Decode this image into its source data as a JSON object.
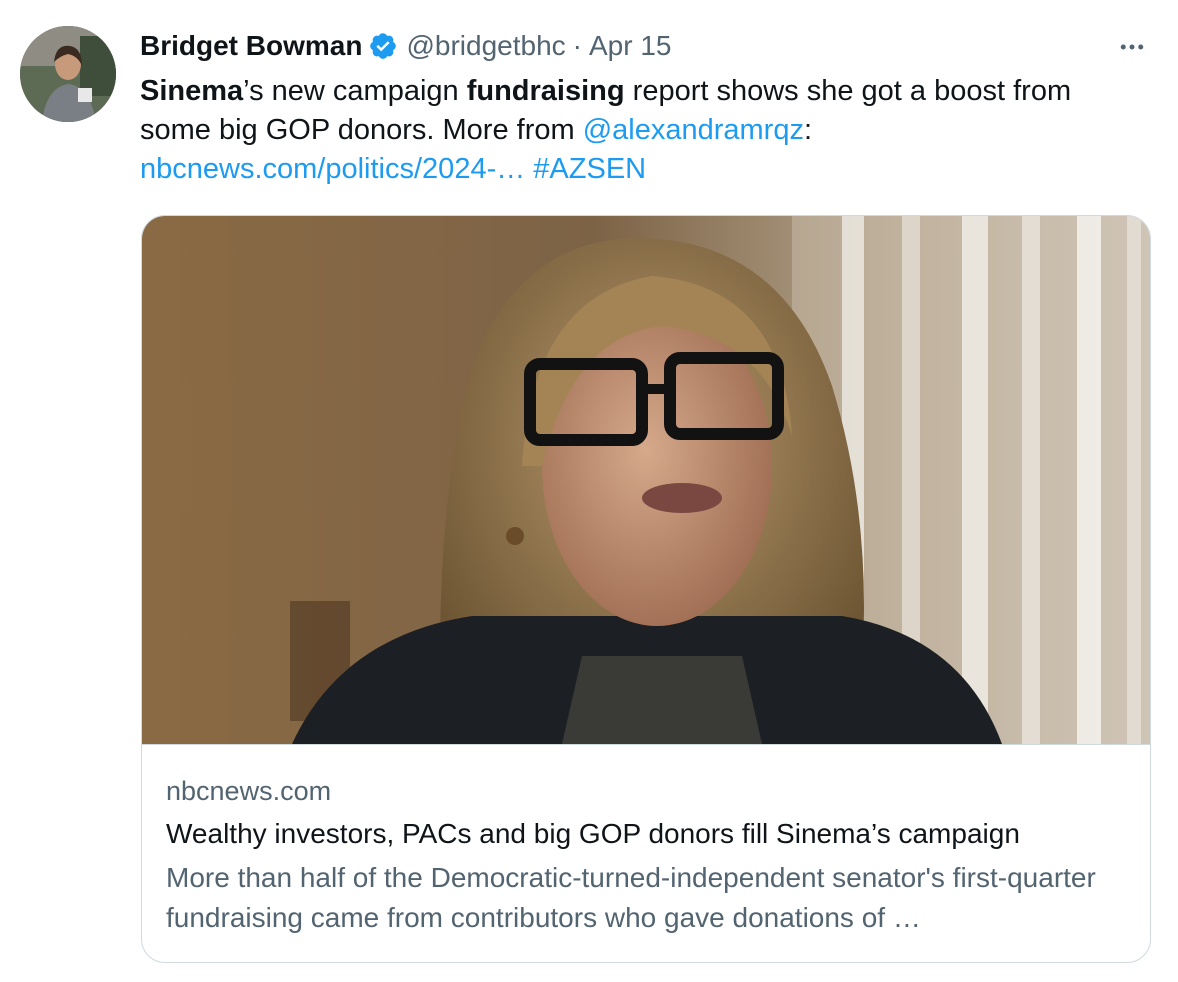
{
  "author": {
    "name": "Bridget Bowman",
    "handle": "@bridgetbhc",
    "separator": "·",
    "date": "Apr 15",
    "verified_color": "#1d9bf0"
  },
  "tweet": {
    "text_parts": {
      "p1": "Sinema",
      "p2": "’s new campaign ",
      "p3": "fundraising",
      "p4": " report shows she got a boost from some big GOP donors. More from ",
      "mention": "@alexandramrqz",
      "p5": ":",
      "url": "nbcnews.com/politics/2024-…",
      "hashtag": "#AZSEN"
    }
  },
  "card": {
    "domain": "nbcnews.com",
    "title": "Wealthy investors, PACs and big GOP donors fill Sinema’s campaign",
    "description": "More than half of the Democratic-turned-independent senator's first-quarter fundraising came from contributors who gave donations of …"
  },
  "icons": {
    "more": "more-horizontal-icon",
    "verified": "verified-badge-icon"
  },
  "colors": {
    "link": "#1d9bf0",
    "secondary_text": "#536471",
    "primary_text": "#0f1419",
    "border": "#cfd9de"
  }
}
